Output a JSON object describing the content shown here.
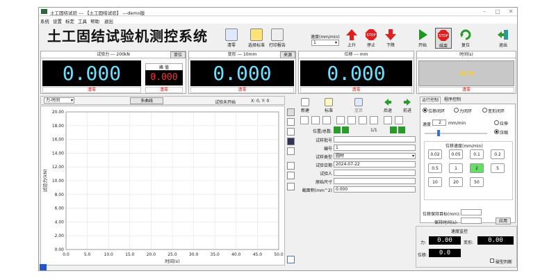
{
  "window": {
    "title": "土工固结试验 --- 【土工固结试验】 ---demo版"
  },
  "menu": [
    "系统",
    "设置",
    "标定",
    "工具",
    "帮助",
    "退出"
  ],
  "app_title": "土工固结试验机测控系统",
  "toolbar": {
    "zero": "清零",
    "select_std": "选择标准",
    "print_report": "打印报告"
  },
  "speed": {
    "label": "速度(mm/min)",
    "value": "1"
  },
  "motion": {
    "up": "上升",
    "stop": "停止",
    "down": "下降"
  },
  "controls": {
    "start": "开始",
    "end": "结束",
    "reset": "复位",
    "exit": "退出"
  },
  "force": {
    "title": "试验力 --- 200kN",
    "unit_btn": "单位",
    "value": "0.000",
    "peak_label": "峰 值",
    "peak_value": "0.000",
    "clear": "清零",
    "clear2": "清零"
  },
  "deform": {
    "title": "变形 --- 10mm",
    "source_btn": "来源",
    "value": "0.000",
    "clear": "清零"
  },
  "disp": {
    "title": "位移 --- mm",
    "value": "0.000",
    "clear": "清零"
  },
  "time": {
    "title": "时间(s)",
    "demo": "演示版",
    "clear": "清零"
  },
  "chart_bar": {
    "mode": "力-时间",
    "multi": "多曲线",
    "status": "试验未开始",
    "coords": "X: 0, Y: 0"
  },
  "chart_data": {
    "type": "line",
    "xlabel": "时间(s)",
    "ylabel": "试验力(kN)",
    "xlim": [
      0,
      50
    ],
    "ylim": [
      0,
      20
    ],
    "x_ticks": [
      "0.0",
      "5.0",
      "10.0",
      "15.0",
      "20.0",
      "25.0",
      "30.0",
      "35.0",
      "40.0",
      "45.0",
      "50.0"
    ],
    "y_ticks": [
      "0.00",
      "2.00",
      "4.00",
      "6.00",
      "8.00",
      "10.00",
      "12.00",
      "14.00",
      "16.00",
      "18.00",
      "20.00"
    ],
    "series": []
  },
  "sample": {
    "new": "新建",
    "standard": "标准",
    "rerun": "重算",
    "back": "后退",
    "forward": "前进",
    "pos_label": "位置/总数:",
    "pos_value": "1/1",
    "fields": [
      {
        "label": "试样批号",
        "value": ""
      },
      {
        "label": "编号",
        "value": "1"
      },
      {
        "label": "试样类型",
        "value": "圆材"
      },
      {
        "label": "试验日期",
        "value": "2024-07-22"
      },
      {
        "label": "试验人",
        "value": ""
      },
      {
        "label": "原始尺寸",
        "value": ""
      },
      {
        "label": "截面积(mm^2)",
        "value": "0.000"
      }
    ]
  },
  "control": {
    "tab1": "运行控制",
    "tab2": "程序控制",
    "modes": [
      "位移闭环",
      "力闭环",
      "变形闭环"
    ],
    "speed_label": "速度",
    "speed_value": "2",
    "speed_unit": "mm/min",
    "dir1": "拉伸",
    "dir2": "压缩",
    "preset_title": "位移速度(mm/min)",
    "presets": [
      "0.02",
      "0.05",
      "0.1",
      "0.2",
      "0.5",
      "1",
      "2",
      "5",
      "10",
      "20",
      "50"
    ],
    "hold_target": "位移保持目标(mm):",
    "hold_time": "保持时间(s):",
    "apply": "应用"
  },
  "monitor": {
    "title": "速度监控",
    "force_label": "力:",
    "force_value": "0.00",
    "deform_label": "变形:",
    "deform_value": "0.00",
    "disp_label": "位移:",
    "disp_value": "0.0",
    "break_check": "破型判断"
  },
  "colors": {
    "lcd_bg": "#000000",
    "lcd_fg": "#6fe0ff",
    "peak_fg": "#ff3030",
    "clear_fg": "#dd0000",
    "selected_preset": "#66dd66",
    "demo_bg": "#c8c8c8",
    "demo_fg": "#ffd000"
  }
}
